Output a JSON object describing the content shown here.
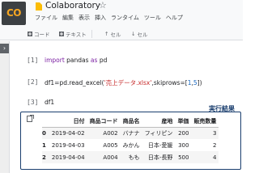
{
  "app": {
    "logo_text": "CO",
    "title": "Colaboratory"
  },
  "menu": [
    "ファイル",
    "編集",
    "表示",
    "挿入",
    "ランタイム",
    "ツール",
    "ヘルプ"
  ],
  "toolbar": {
    "code_label": "コード",
    "text_label": "テキスト",
    "cell_up_label": "セル",
    "cell_down_label": "セル"
  },
  "cells": [
    {
      "num": "[1]",
      "code": {
        "kw1": "import",
        "mod": " pandas ",
        "kw2": "as",
        "alias": " pd"
      }
    },
    {
      "num": "[2]",
      "code": {
        "pre": "df1=pd.read_excel(",
        "str": "'売上データ.xlsx'",
        "mid": ",skiprows=[",
        "n1": "1",
        "comma": ",",
        "n2": "5",
        "post": "])"
      }
    },
    {
      "num": "[3]",
      "code": {
        "text": "df1"
      }
    }
  ],
  "result_label": "実行結果",
  "table": {
    "headers": [
      "",
      "日付",
      "商品コード",
      "商品名",
      "産地",
      "単価",
      "販売数量"
    ],
    "rows": [
      [
        "0",
        "2019-04-02",
        "A002",
        "バナナ",
        "フィリピン",
        "200",
        "3"
      ],
      [
        "1",
        "2019-04-03",
        "A005",
        "みかん",
        "日本-愛媛",
        "300",
        "2"
      ],
      [
        "2",
        "2019-04-04",
        "A004",
        "もも",
        "日本-長野",
        "500",
        "4"
      ]
    ]
  }
}
